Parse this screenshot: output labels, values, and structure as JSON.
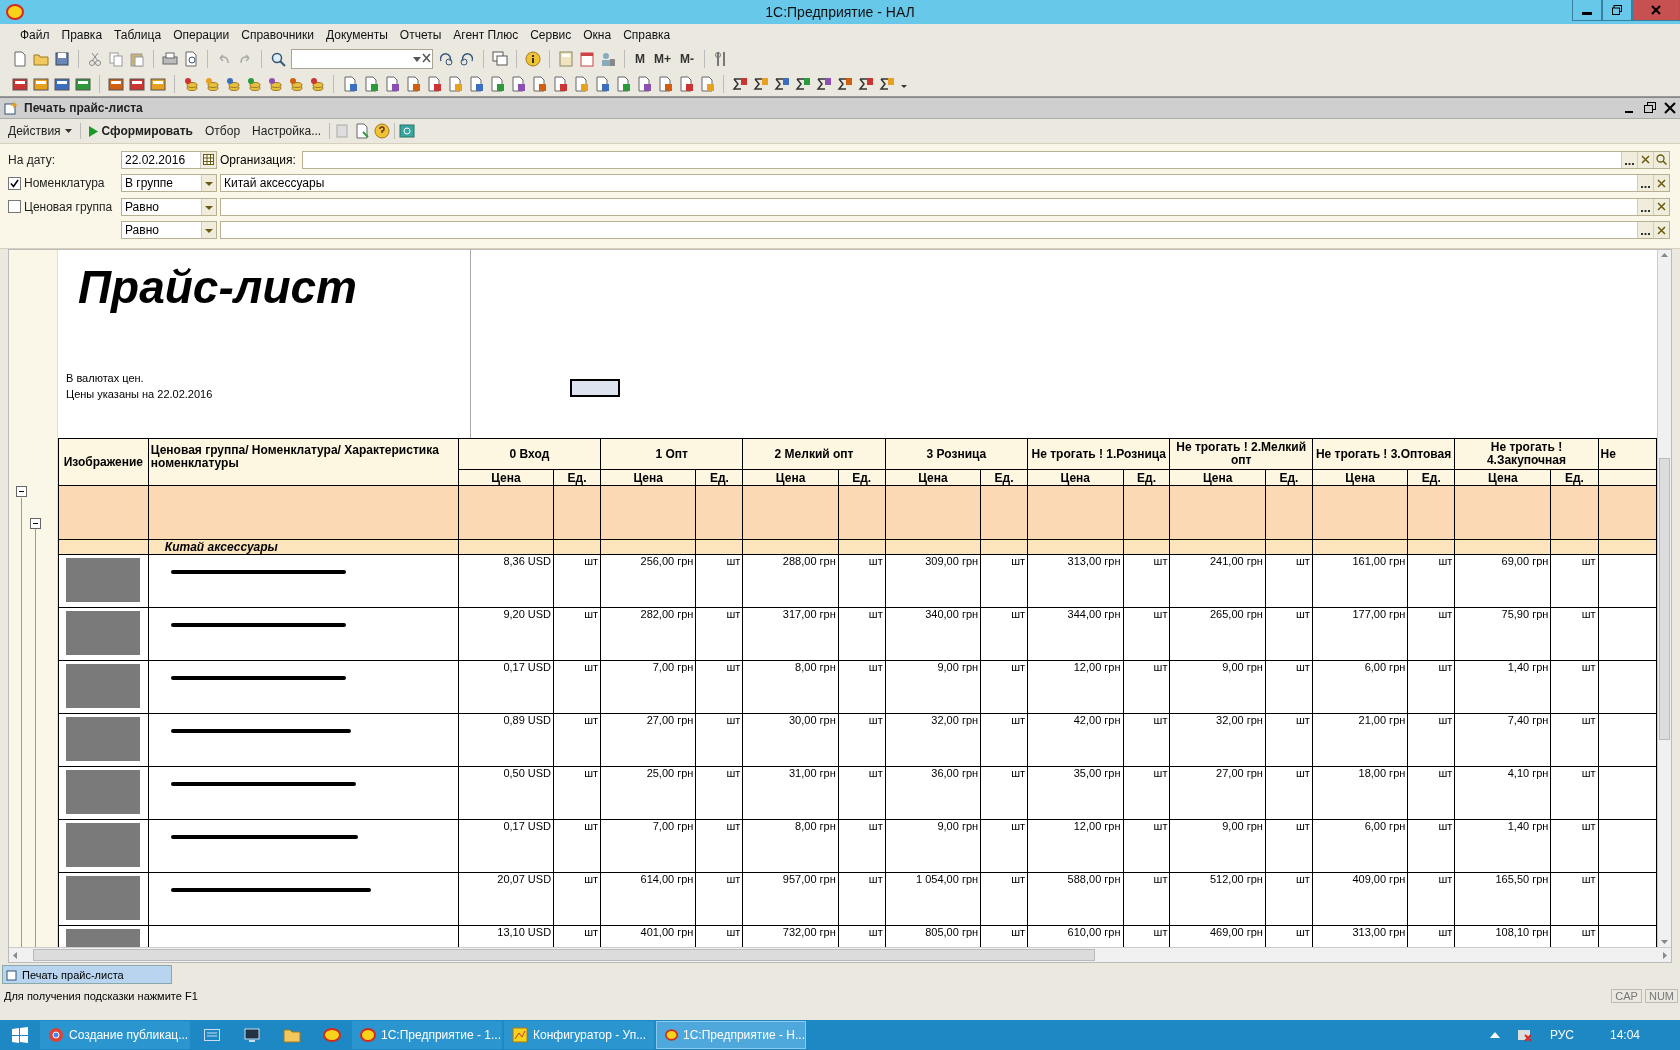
{
  "window": {
    "title": "1С:Предприятие - НАЛ"
  },
  "menu": [
    "Файл",
    "Правка",
    "Таблица",
    "Операции",
    "Справочники",
    "Документы",
    "Отчеты",
    "Агент Плюс",
    "Сервис",
    "Окна",
    "Справка"
  ],
  "toolbar": {
    "memory_buttons": [
      "M",
      "M+",
      "M-"
    ]
  },
  "panel": {
    "title": "Печать прайс-листа",
    "actions": [
      {
        "label": "Действия",
        "kind": "dropdown"
      },
      {
        "label": "Сформировать",
        "kind": "run"
      },
      {
        "label": "Отбор",
        "kind": "plain"
      },
      {
        "label": "Настройка...",
        "kind": "plain"
      }
    ]
  },
  "filters": {
    "date_label": "На дату:",
    "date": "22.02.2016",
    "organization_label": "Организация:",
    "rows": [
      {
        "label": "Номенклатура",
        "checked": true,
        "condition": "В группе",
        "value": "Китай аксессуары"
      },
      {
        "label": "Ценовая группа",
        "checked": false,
        "condition": "Равно"
      }
    ],
    "covered_row": {
      "condition": "Равно"
    }
  },
  "report": {
    "title": "Прайс-лист",
    "notes": [
      "В валютах цен.",
      "Цены указаны на 22.02.2016"
    ],
    "image_header": "Изображение",
    "name_header": "Ценовая группа/ Номенклатура/ Характеристика номенклатуры",
    "price_groups": [
      {
        "name": "0 Вход",
        "price_label": "Цена",
        "unit_label": "Ед."
      },
      {
        "name": "1 Опт",
        "price_label": "Цена",
        "unit_label": "Ед."
      },
      {
        "name": "2 Мелкий опт",
        "price_label": "Цена",
        "unit_label": "Ед."
      },
      {
        "name": "3 Розница",
        "price_label": "Цена",
        "unit_label": "Ед."
      },
      {
        "name": "Не трогать ! 1.Розница",
        "price_label": "Цена",
        "unit_label": "Ед."
      },
      {
        "name": "Не трогать ! 2.Мелкий опт",
        "price_label": "Цена",
        "unit_label": "Ед."
      },
      {
        "name": "Не трогать ! 3.Оптовая",
        "price_label": "Цена",
        "unit_label": "Ед."
      },
      {
        "name": "Не трогать ! 4.Закупочная",
        "price_label": "Цена",
        "unit_label": "Ед."
      }
    ],
    "cut_group": "Не",
    "group_row": "Китай аксессуары",
    "rows": [
      {
        "cells": [
          {
            "price": "8,36 USD",
            "unit": "шт"
          },
          {
            "price": "256,00 грн",
            "unit": "шт"
          },
          {
            "price": "288,00 грн",
            "unit": "шт"
          },
          {
            "price": "309,00 грн",
            "unit": "шт"
          },
          {
            "price": "313,00 грн",
            "unit": "шт"
          },
          {
            "price": "241,00 грн",
            "unit": "шт"
          },
          {
            "price": "161,00 грн",
            "unit": "шт"
          },
          {
            "price": "69,00 грн",
            "unit": "шт"
          }
        ]
      },
      {
        "cells": [
          {
            "price": "9,20 USD",
            "unit": "шт"
          },
          {
            "price": "282,00 грн",
            "unit": "шт"
          },
          {
            "price": "317,00 грн",
            "unit": "шт"
          },
          {
            "price": "340,00 грн",
            "unit": "шт"
          },
          {
            "price": "344,00 грн",
            "unit": "шт"
          },
          {
            "price": "265,00 грн",
            "unit": "шт"
          },
          {
            "price": "177,00 грн",
            "unit": "шт"
          },
          {
            "price": "75,90 грн",
            "unit": "шт"
          }
        ]
      },
      {
        "cells": [
          {
            "price": "0,17 USD",
            "unit": "шт"
          },
          {
            "price": "7,00 грн",
            "unit": "шт"
          },
          {
            "price": "8,00 грн",
            "unit": "шт"
          },
          {
            "price": "9,00 грн",
            "unit": "шт"
          },
          {
            "price": "12,00 грн",
            "unit": "шт"
          },
          {
            "price": "9,00 грн",
            "unit": "шт"
          },
          {
            "price": "6,00 грн",
            "unit": "шт"
          },
          {
            "price": "1,40 грн",
            "unit": "шт"
          }
        ]
      },
      {
        "cells": [
          {
            "price": "0,89 USD",
            "unit": "шт"
          },
          {
            "price": "27,00 грн",
            "unit": "шт"
          },
          {
            "price": "30,00 грн",
            "unit": "шт"
          },
          {
            "price": "32,00 грн",
            "unit": "шт"
          },
          {
            "price": "42,00 грн",
            "unit": "шт"
          },
          {
            "price": "32,00 грн",
            "unit": "шт"
          },
          {
            "price": "21,00 грн",
            "unit": "шт"
          },
          {
            "price": "7,40 грн",
            "unit": "шт"
          }
        ]
      },
      {
        "cells": [
          {
            "price": "0,50 USD",
            "unit": "шт"
          },
          {
            "price": "25,00 грн",
            "unit": "шт"
          },
          {
            "price": "31,00 грн",
            "unit": "шт"
          },
          {
            "price": "36,00 грн",
            "unit": "шт"
          },
          {
            "price": "35,00 грн",
            "unit": "шт"
          },
          {
            "price": "27,00 грн",
            "unit": "шт"
          },
          {
            "price": "18,00 грн",
            "unit": "шт"
          },
          {
            "price": "4,10 грн",
            "unit": "шт"
          }
        ]
      },
      {
        "cells": [
          {
            "price": "0,17 USD",
            "unit": "шт"
          },
          {
            "price": "7,00 грн",
            "unit": "шт"
          },
          {
            "price": "8,00 грн",
            "unit": "шт"
          },
          {
            "price": "9,00 грн",
            "unit": "шт"
          },
          {
            "price": "12,00 грн",
            "unit": "шт"
          },
          {
            "price": "9,00 грн",
            "unit": "шт"
          },
          {
            "price": "6,00 грн",
            "unit": "шт"
          },
          {
            "price": "1,40 грн",
            "unit": "шт"
          }
        ]
      },
      {
        "cells": [
          {
            "price": "20,07 USD",
            "unit": "шт"
          },
          {
            "price": "614,00 грн",
            "unit": "шт"
          },
          {
            "price": "957,00 грн",
            "unit": "шт"
          },
          {
            "price": "1 054,00 грн",
            "unit": "шт"
          },
          {
            "price": "588,00 грн",
            "unit": "шт"
          },
          {
            "price": "512,00 грн",
            "unit": "шт"
          },
          {
            "price": "409,00 грн",
            "unit": "шт"
          },
          {
            "price": "165,50 грн",
            "unit": "шт"
          }
        ]
      },
      {
        "cells": [
          {
            "price": "13,10 USD",
            "unit": "шт"
          },
          {
            "price": "401,00 грн",
            "unit": "шт"
          },
          {
            "price": "732,00 грн",
            "unit": "шт"
          },
          {
            "price": "805,00 грн",
            "unit": "шт"
          },
          {
            "price": "610,00 грн",
            "unit": "шт"
          },
          {
            "price": "469,00 грн",
            "unit": "шт"
          },
          {
            "price": "313,00 грн",
            "unit": "шт"
          },
          {
            "price": "108,10 грн",
            "unit": "шт"
          }
        ]
      }
    ]
  },
  "window_tab": "Печать прайс-листа",
  "status_bar": {
    "hint": "Для получения подсказки нажмите F1",
    "indicators": [
      "CAP",
      "NUM"
    ]
  },
  "taskbar": {
    "items": [
      {
        "label": "Создание публикац...",
        "kind": "browser",
        "selected": false
      },
      {
        "label": "1С:Предприятие - 1...",
        "kind": "onec",
        "selected": false
      },
      {
        "label": "Конфигуратор - Уп...",
        "kind": "config",
        "selected": false
      },
      {
        "label": "1С:Предприятие - Н...",
        "kind": "onec",
        "selected": true
      }
    ],
    "language": "РУС",
    "time": "14:04"
  }
}
